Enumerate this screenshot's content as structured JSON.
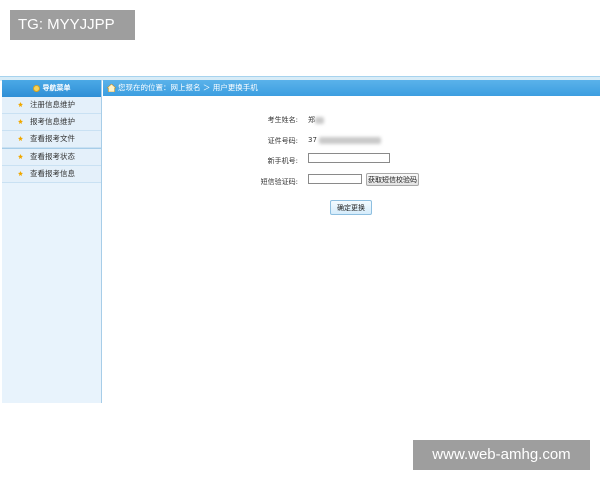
{
  "watermarks": {
    "top_left": "TG: MYYJJPP",
    "bottom_right": "www.web-amhg.com"
  },
  "sidebar": {
    "header": "导航菜单",
    "items": [
      {
        "label": "注册信息维护"
      },
      {
        "label": "报考信息维护"
      },
      {
        "label": "查看报考文件"
      },
      {
        "label": "查看报考状态"
      },
      {
        "label": "查看报考信息"
      }
    ]
  },
  "breadcrumb": {
    "text": "您现在的位置：网上报名 ＞ 用户更换手机"
  },
  "form": {
    "name_label": "考生姓名:",
    "name_value": "郑",
    "id_label": "证件号码:",
    "id_value": "37",
    "new_phone_label": "新手机号:",
    "new_phone_value": "",
    "sms_code_label": "短信验证码:",
    "sms_code_value": "",
    "get_code_button": "获取短信校验码",
    "submit_button": "确定更换"
  },
  "colors": {
    "header_blue": "#3c9ee0",
    "sidebar_bg": "#e8f3fc"
  }
}
